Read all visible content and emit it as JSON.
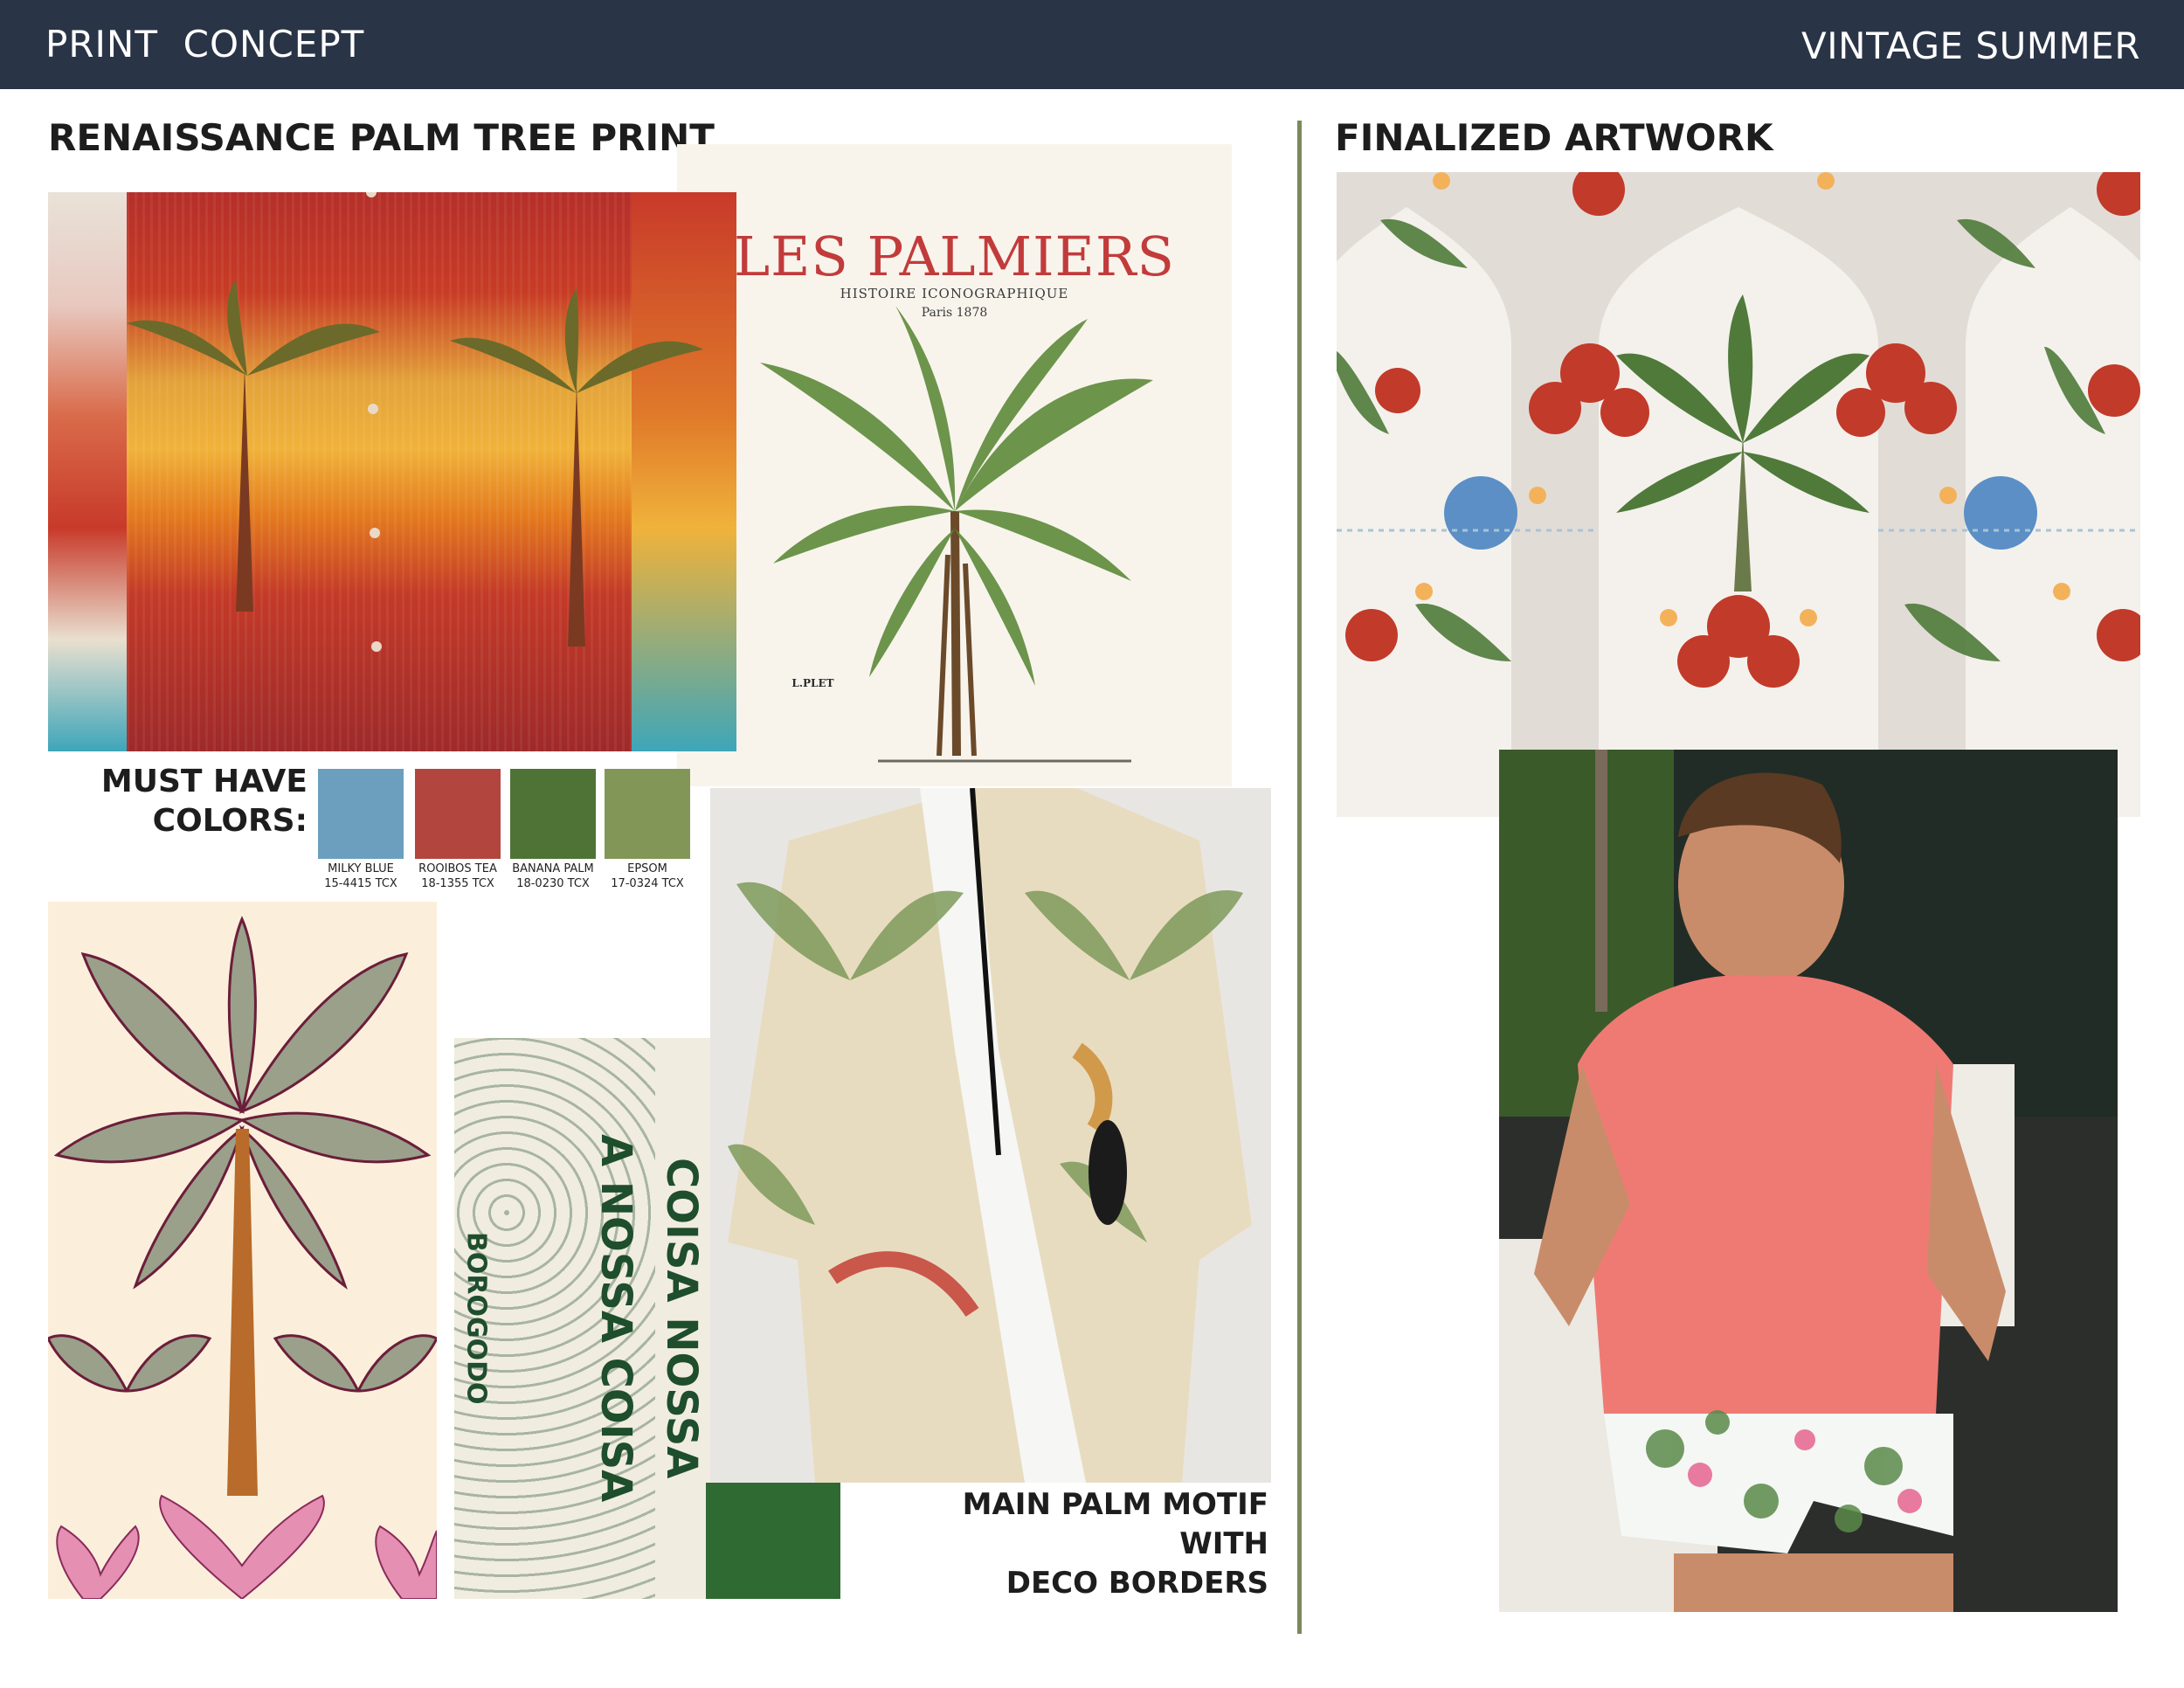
{
  "header": {
    "left_title": "PRINT  CONCEPT",
    "right_title": "VINTAGE SUMMER",
    "bar_color": "#2a3447"
  },
  "left_section": {
    "title": "RENAISSANCE PALM TREE PRINT",
    "book": {
      "title": "LES PALMIERS",
      "subtitle": "HISTOIRE ICONOGRAPHIQUE",
      "place_year": "Paris 1878",
      "label": "L.PLET"
    },
    "must_have_label_line1": "MUST HAVE",
    "must_have_label_line2": "COLORS:",
    "colors": [
      {
        "name": "MILKY BLUE",
        "code": "15-4415 TCX",
        "hex": "#6b9fbd"
      },
      {
        "name": "ROOIBOS TEA",
        "code": "18-1355 TCX",
        "hex": "#b3453f"
      },
      {
        "name": "BANANA PALM",
        "code": "18-0230 TCX",
        "hex": "#4f7336"
      },
      {
        "name": "EPSOM",
        "code": "17-0324 TCX",
        "hex": "#829757"
      }
    ],
    "typo_print": {
      "word1": "A NOSSA COISA",
      "word2": "COISA NOSSA",
      "word3": "BOROGODO",
      "word4": "A NOSSA COISA"
    },
    "caption_line1": "MAIN PALM MOTIF WITH",
    "caption_line2": "DECO BORDERS"
  },
  "right_section": {
    "title": "FINALIZED ARTWORK",
    "divider_color": "#7a8a5a"
  }
}
